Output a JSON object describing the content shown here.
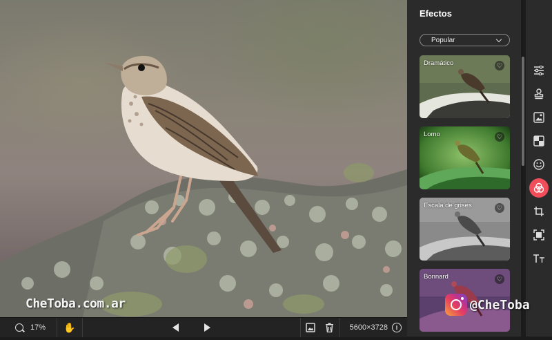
{
  "panel": {
    "title": "Efectos",
    "filter": {
      "selected": "Popular"
    },
    "effects": [
      {
        "label": "Dramático",
        "favorite_icon": "heart-outline-icon"
      },
      {
        "label": "Lomo",
        "favorite_icon": "heart-outline-icon"
      },
      {
        "label": "Escala de grises",
        "favorite_icon": "heart-outline-icon"
      },
      {
        "label": "Bonnard",
        "favorite_icon": "heart-outline-icon"
      }
    ]
  },
  "toolbar": {
    "tools": [
      {
        "icon": "adjustments-sliders-icon"
      },
      {
        "icon": "stamp-icon"
      },
      {
        "icon": "image-overlay-icon"
      },
      {
        "icon": "texture-icon"
      },
      {
        "icon": "smiley-sticker-icon"
      },
      {
        "icon": "effects-circles-icon",
        "active": true
      },
      {
        "icon": "crop-icon"
      },
      {
        "icon": "frame-icon"
      },
      {
        "icon": "text-icon"
      }
    ],
    "accent_color": "#ef4e5a"
  },
  "canvas": {
    "watermark": "CheToba.com.ar",
    "instagram_handle": "@CheToba"
  },
  "bottom_bar": {
    "zoom": "17%",
    "dimensions": "5600×3728",
    "info_icon": "i"
  }
}
